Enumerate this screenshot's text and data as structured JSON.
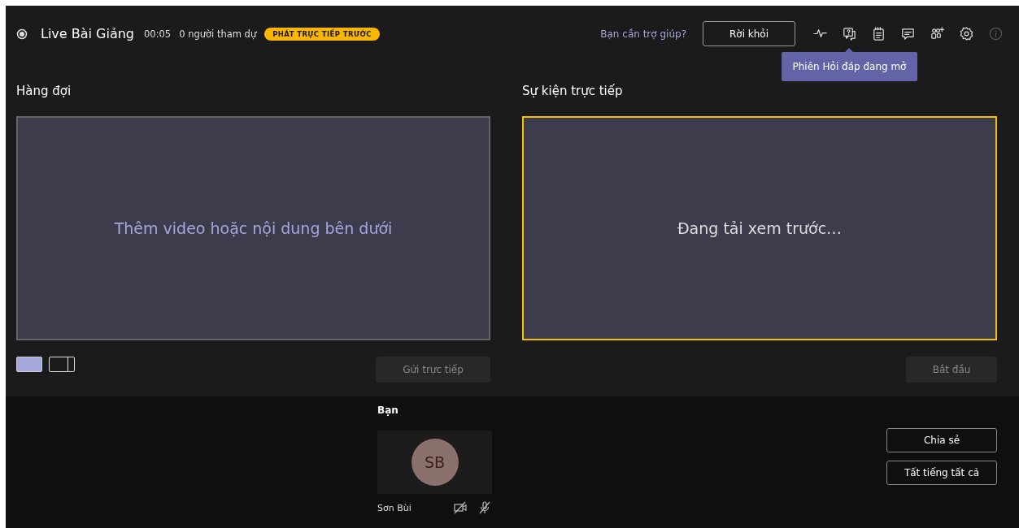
{
  "header": {
    "title": "Live Bài Giảng",
    "timer": "00:05",
    "attendees": "0 người tham dự",
    "badge": "PHÁT TRỰC TIẾP TRƯỚC",
    "help_link": "Bạn cần trợ giúp?",
    "leave_button": "Rời khỏi",
    "toolbar": [
      {
        "kind": "health",
        "disabled": false
      },
      {
        "kind": "qa",
        "disabled": false,
        "tooltip": "Phiên Hỏi đáp đang mở"
      },
      {
        "kind": "notes",
        "disabled": false
      },
      {
        "kind": "chat",
        "disabled": false
      },
      {
        "kind": "people",
        "disabled": false
      },
      {
        "kind": "settings",
        "disabled": false
      },
      {
        "kind": "info",
        "disabled": true
      }
    ]
  },
  "queue": {
    "title": "Hàng đợi",
    "message": "Thêm video hoặc nội dung bên dưới",
    "layouts": [
      {
        "kind": "single",
        "selected": true
      },
      {
        "kind": "split",
        "selected": false
      }
    ],
    "send_button": {
      "label": "Gửi trực tiếp",
      "disabled": true
    }
  },
  "live": {
    "title": "Sự kiện trực tiếp",
    "message": "Đang tải xem trước…",
    "start_button": {
      "label": "Bắt đầu",
      "disabled": true
    }
  },
  "participants": {
    "title": "Bạn",
    "items": [
      {
        "initials": "SB",
        "name": "Sơn Bùi",
        "camera_off": true,
        "muted": true
      }
    ]
  },
  "actions": [
    "Chia sẻ",
    "Tất tiếng tất cả"
  ]
}
